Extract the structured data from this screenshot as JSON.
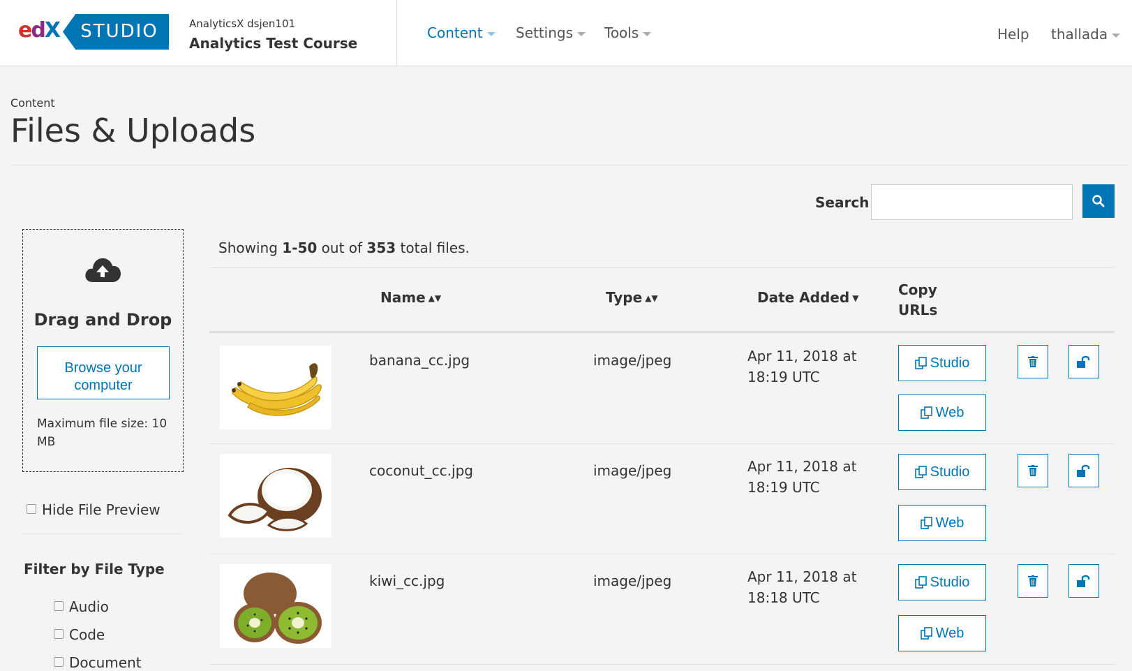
{
  "header": {
    "course_org": "AnalyticsX  dsjen101",
    "course_title": "Analytics Test Course",
    "studio_label": "STUDIO",
    "logo_text": "edX",
    "nav": [
      "Content",
      "Settings",
      "Tools"
    ],
    "help": "Help",
    "user": "thallada"
  },
  "page": {
    "breadcrumb": "Content",
    "title": "Files & Uploads"
  },
  "search": {
    "label": "Search",
    "value": "",
    "placeholder": ""
  },
  "upload": {
    "title": "Drag and Drop",
    "browse_label": "Browse your computer",
    "max_size": "Maximum file size: 10 MB"
  },
  "sidebar": {
    "hide_preview_label": "Hide File Preview",
    "filter_title": "Filter by File Type",
    "filter_options": [
      "Audio",
      "Code",
      "Document"
    ]
  },
  "summary": {
    "prefix": "Showing ",
    "range": "1-50",
    "middle": " out of ",
    "total": "353",
    "suffix": " total files."
  },
  "table": {
    "headers": {
      "name": "Name",
      "type": "Type",
      "date_added": "Date Added",
      "copy_urls": "Copy URLs"
    },
    "studio_label": "Studio",
    "web_label": "Web",
    "rows": [
      {
        "name": "banana_cc.jpg",
        "type": "image/jpeg",
        "date": "Apr 11, 2018 at 18:19 UTC",
        "thumb": "banana"
      },
      {
        "name": "coconut_cc.jpg",
        "type": "image/jpeg",
        "date": "Apr 11, 2018 at 18:19 UTC",
        "thumb": "coconut"
      },
      {
        "name": "kiwi_cc.jpg",
        "type": "image/jpeg",
        "date": "Apr 11, 2018 at 18:18 UTC",
        "thumb": "kiwi"
      }
    ]
  },
  "colors": {
    "accent": "#0075b4",
    "background": "#f4f4f4"
  }
}
